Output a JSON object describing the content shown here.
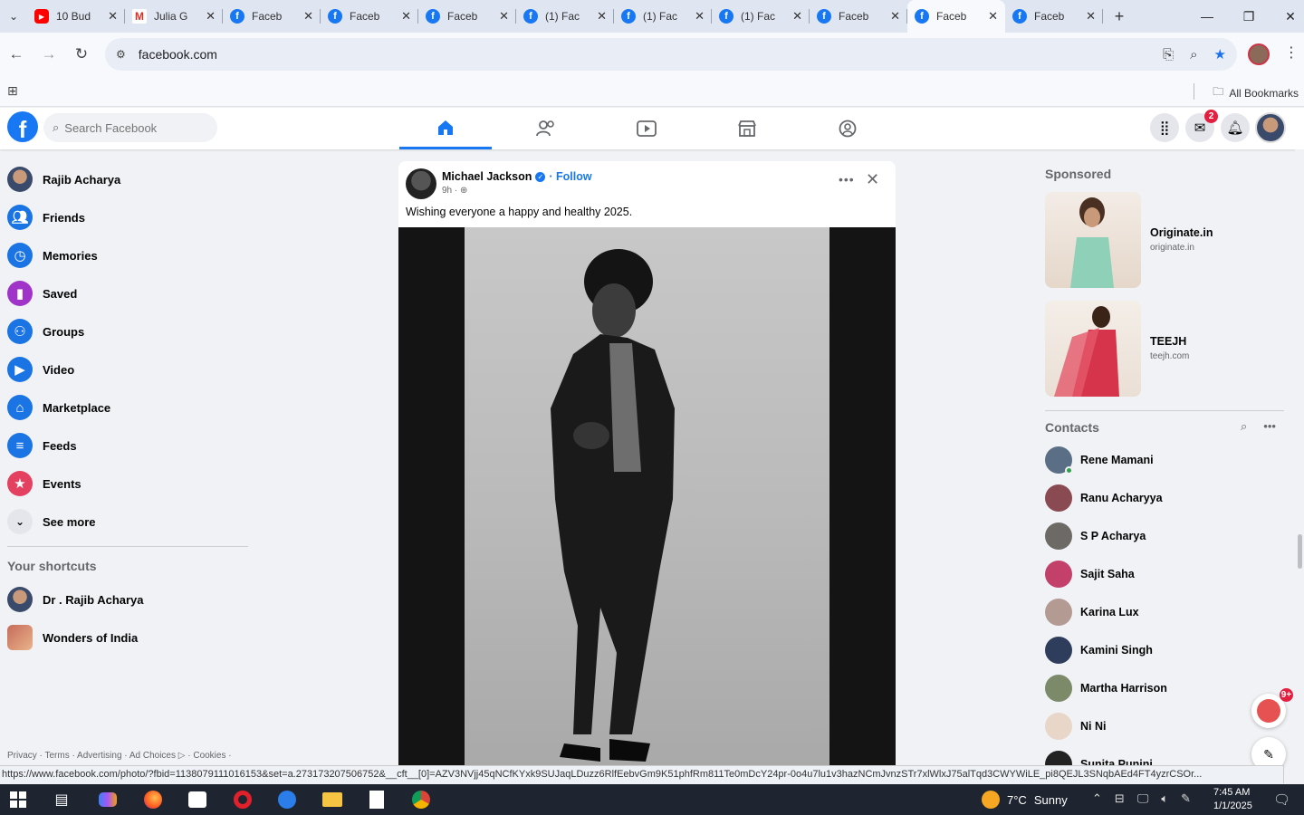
{
  "browser": {
    "tabs": [
      {
        "title": "10 Bud",
        "icon": "youtube-icon"
      },
      {
        "title": "Julia G",
        "icon": "gmail-icon"
      },
      {
        "title": "Faceb",
        "icon": "facebook-icon"
      },
      {
        "title": "Faceb",
        "icon": "facebook-icon"
      },
      {
        "title": "Faceb",
        "icon": "facebook-icon"
      },
      {
        "title": "(1) Fac",
        "icon": "facebook-icon"
      },
      {
        "title": "(1) Fac",
        "icon": "facebook-icon"
      },
      {
        "title": "(1) Fac",
        "icon": "facebook-icon"
      },
      {
        "title": "Faceb",
        "icon": "facebook-icon"
      },
      {
        "title": "Faceb",
        "icon": "facebook-icon",
        "active": true
      },
      {
        "title": "Faceb",
        "icon": "facebook-icon"
      }
    ],
    "url": "facebook.com",
    "bookmarks_label": "All Bookmarks"
  },
  "fb": {
    "search_placeholder": "Search Facebook",
    "messenger_badge": "2",
    "left_menu": [
      {
        "label": "Rajib Acharya",
        "icon": "profile-avatar"
      },
      {
        "label": "Friends",
        "icon": "friends-icon"
      },
      {
        "label": "Memories",
        "icon": "memories-icon"
      },
      {
        "label": "Saved",
        "icon": "saved-icon"
      },
      {
        "label": "Groups",
        "icon": "groups-icon"
      },
      {
        "label": "Video",
        "icon": "video-icon"
      },
      {
        "label": "Marketplace",
        "icon": "marketplace-icon"
      },
      {
        "label": "Feeds",
        "icon": "feeds-icon"
      },
      {
        "label": "Events",
        "icon": "events-icon"
      },
      {
        "label": "See more",
        "icon": "chevron-down-icon"
      }
    ],
    "shortcuts_title": "Your shortcuts",
    "shortcuts": [
      "Dr . Rajib Acharya",
      "Wonders of India"
    ],
    "footer": "Privacy · Terms · Advertising · Ad Choices ▷ · Cookies ·",
    "post": {
      "author": "Michael Jackson",
      "follow": "· Follow",
      "time": "9h · ",
      "text": "Wishing everyone a happy and healthy 2025."
    },
    "sponsored_title": "Sponsored",
    "ads": [
      {
        "name": "Originate.in",
        "url": "originate.in"
      },
      {
        "name": "TEEJH",
        "url": "teejh.com"
      }
    ],
    "contacts_title": "Contacts",
    "contacts": [
      {
        "name": "Rene Mamani",
        "online": true,
        "color": "#5a6f86"
      },
      {
        "name": "Ranu Acharyya",
        "online": false,
        "color": "#8a4a52"
      },
      {
        "name": "S P Acharya",
        "online": false,
        "color": "#6d6a66"
      },
      {
        "name": "Sajit Saha",
        "online": false,
        "color": "#c2406a"
      },
      {
        "name": "Karina Lux",
        "online": false,
        "color": "#b39a92"
      },
      {
        "name": "Kamini Singh",
        "online": false,
        "color": "#2f3d5c"
      },
      {
        "name": "Martha Harrison",
        "online": false,
        "color": "#7c8a6a"
      },
      {
        "name": "Ni Ni",
        "online": false,
        "color": "#e8d6c8"
      },
      {
        "name": "Sunita Punini",
        "online": false,
        "color": "#222222"
      }
    ],
    "chat_badge": "9+"
  },
  "status_url": "https://www.facebook.com/photo/?fbid=1138079111016153&set=a.273173207506752&__cft__[0]=AZV3NVjj45qNCfKYxk9SUJaqLDuzz6RlfEebvGm9K51phfRm811Te0mDcY24pr-0o4u7lu1v3hazNCmJvnzSTr7xlWlxJ75alTqd3CWYWiLE_pi8QEJL3SNqbAEd4FT4yzrCSOr...",
  "taskbar": {
    "weather_temp": "7°C",
    "weather_desc": "Sunny",
    "time": "7:45 AM",
    "date": "1/1/2025"
  }
}
